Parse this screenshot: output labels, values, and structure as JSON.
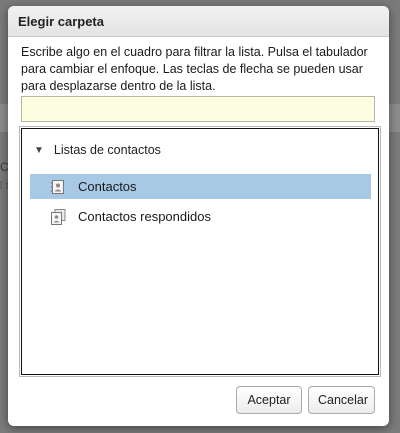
{
  "background": {
    "fragment_1": "Co",
    "fragment_2": "l t"
  },
  "dialog": {
    "title": "Elegir carpeta",
    "instructions": "Escribe algo en el cuadro para filtrar la lista. Pulsa el tabulador para cambiar el enfoque. Las teclas de flecha se pueden usar para desplazarse dentro de la lista.",
    "filter": {
      "value": "",
      "placeholder": ""
    },
    "tree": {
      "root_label": "Listas de contactos",
      "root_expanded": true,
      "items": [
        {
          "label": "Contactos",
          "icon": "address-book-icon",
          "selected": true
        },
        {
          "label": "Contactos respondidos",
          "icon": "address-book-stack-icon",
          "selected": false
        }
      ]
    },
    "buttons": {
      "ok_label": "Aceptar",
      "cancel_label": "Cancelar"
    }
  },
  "colors": {
    "selection": "#a7c9e6",
    "filter_background": "#fdfde2",
    "overlay": "#7b7b7b"
  }
}
